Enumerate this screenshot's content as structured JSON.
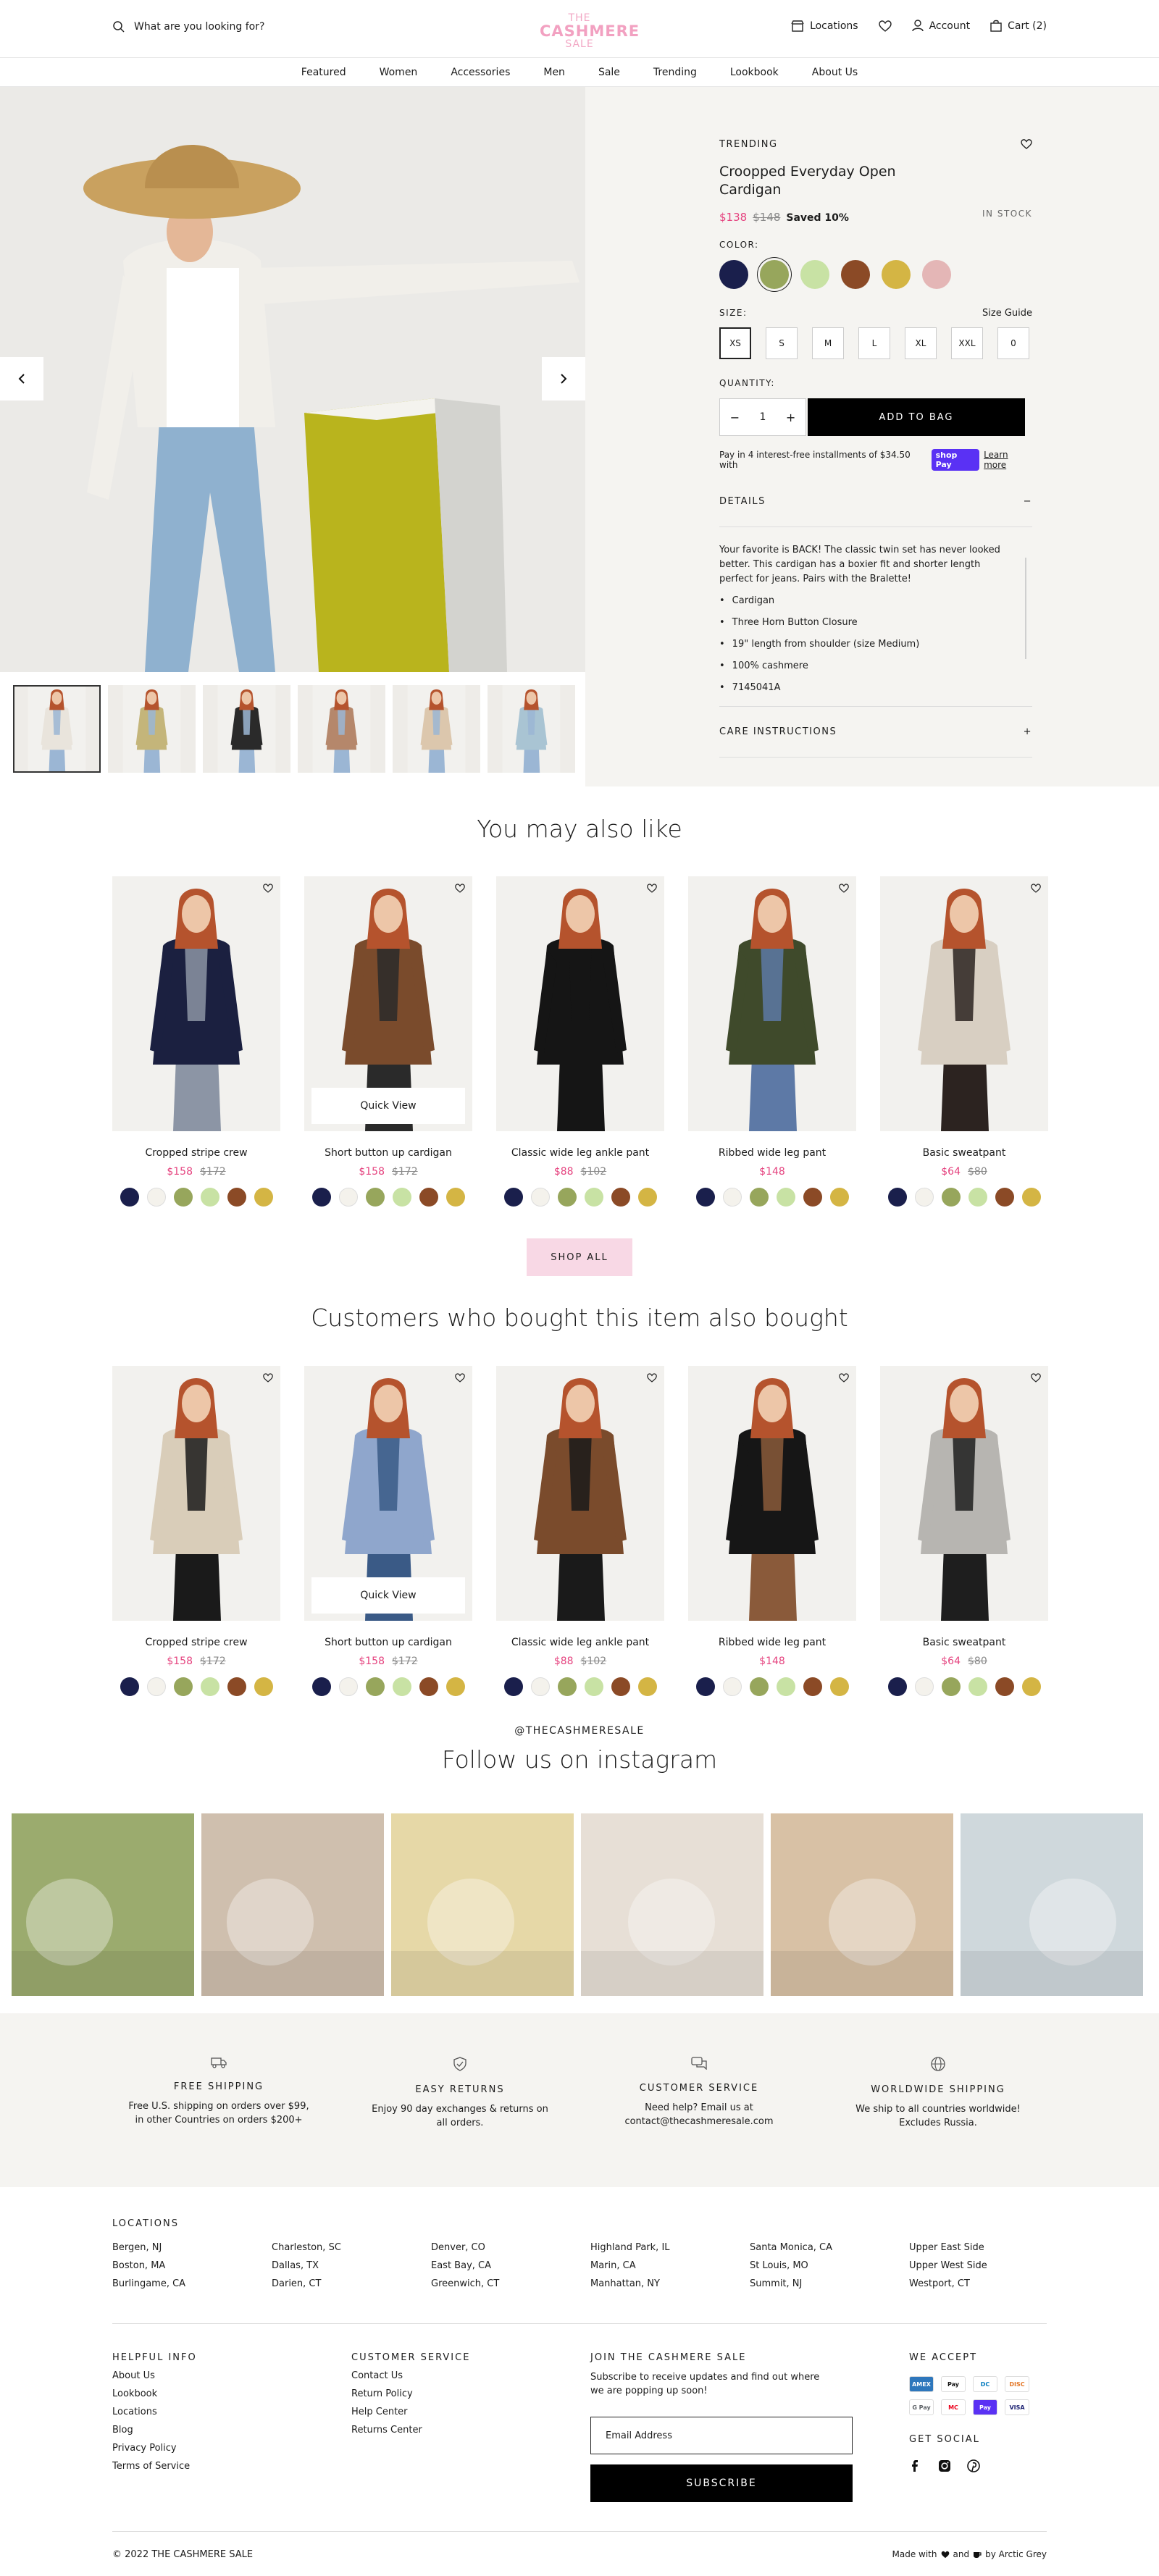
{
  "header": {
    "search_placeholder": "What are you looking for?",
    "logo_top": "THE",
    "logo_main": "CASHMERE",
    "logo_bottom": "SALE",
    "locations": "Locations",
    "account": "Account",
    "cart": "Cart (2)"
  },
  "nav": [
    "Featured",
    "Women",
    "Accessories",
    "Men",
    "Sale",
    "Trending",
    "Lookbook",
    "About Us"
  ],
  "product": {
    "tag": "TRENDING",
    "title": "Croopped Everyday Open Cardigan",
    "price": "$138",
    "compare_price": "$148",
    "saved": "Saved 10%",
    "stock": "IN STOCK",
    "color_label": "COLOR:",
    "colors": [
      "#1a1f4c",
      "#97a65c",
      "#c8e2a4",
      "#8b4a26",
      "#d4b544",
      "#e4b6b6"
    ],
    "selected_color": 1,
    "size_label": "SIZE:",
    "size_guide": "Size Guide",
    "sizes": [
      "XS",
      "S",
      "M",
      "L",
      "XL",
      "XXL",
      "0"
    ],
    "selected_size": 0,
    "quantity_label": "QUANTITY:",
    "quantity": "1",
    "add_to_bag": "ADD TO BAG",
    "pay_text": "Pay in 4 interest-free installments of $34.50 with",
    "shop_pay": "shop Pay",
    "learn_more": "Learn more",
    "details_label": "DETAILS",
    "details_text": "Your favorite is BACK! The classic twin set has never looked better. This cardigan has a boxier fit and shorter length perfect for jeans. Pairs with the Bralette!",
    "details_bullets": [
      "Cardigan",
      "Three Horn Button Closure",
      "19\" length from shoulder (size Medium)",
      "100% cashmere",
      "7145041A"
    ],
    "care_label": "CARE INSTRUCTIONS",
    "thumb_colors": [
      "#e9e4dc",
      "#c4b57a",
      "#2a2a2a",
      "#b5876b",
      "#dcc7ad",
      "#a9c4d3"
    ]
  },
  "swatch_colors": [
    "#1a1f4c",
    "#f4f2ec",
    "#97a65c",
    "#c8e2a4",
    "#8b4a26",
    "#d4b544"
  ],
  "also_like": {
    "title": "You may also like",
    "quick_view": "Quick View",
    "shop_all": "SHOP ALL",
    "items": [
      {
        "name": "Cropped stripe crew",
        "price": "$158",
        "compare": "$172",
        "garment": "#1b2040",
        "inner": "#8c95a5"
      },
      {
        "name": "Short button up cardigan",
        "price": "$158",
        "compare": "$172",
        "garment": "#7a4b2c",
        "inner": "#2a2a2a"
      },
      {
        "name": "Classic wide leg ankle pant",
        "price": "$88",
        "compare": "$102",
        "garment": "#151515",
        "inner": "#151515"
      },
      {
        "name": "Ribbed wide leg pant",
        "price": "$148",
        "compare": "",
        "garment": "#3f4a2b",
        "inner": "#5d79a6"
      },
      {
        "name": "Basic sweatpant",
        "price": "$64",
        "compare": "$80",
        "garment": "#d8cfc2",
        "inner": "#2c2320"
      }
    ]
  },
  "also_bought": {
    "title": "Customers who bought this item also bought",
    "items": [
      {
        "name": "Cropped stripe crew",
        "price": "$158",
        "compare": "$172",
        "garment": "#d9cdb9",
        "inner": "#1a1a1a"
      },
      {
        "name": "Short button up cardigan",
        "price": "$158",
        "compare": "$172",
        "garment": "#8fa6cc",
        "inner": "#3a5a86"
      },
      {
        "name": "Classic wide leg ankle pant",
        "price": "$88",
        "compare": "$102",
        "garment": "#7a4b2c",
        "inner": "#1a1a1a"
      },
      {
        "name": "Ribbed wide leg pant",
        "price": "$148",
        "compare": "",
        "garment": "#161616",
        "inner": "#8a5a3a"
      },
      {
        "name": "Basic sweatpant",
        "price": "$64",
        "compare": "$80",
        "garment": "#b7b5b1",
        "inner": "#1e1e1e"
      }
    ]
  },
  "instagram": {
    "handle": "@THECASHMERESALE",
    "title": "Follow us on instagram",
    "tiles": [
      "#9bab6e",
      "#cfbfae",
      "#e6d8a7",
      "#e7dfd6",
      "#d8c1a5",
      "#cfd8dc"
    ]
  },
  "features": [
    {
      "title": "FREE SHIPPING",
      "text": "Free U.S. shipping on orders over $99, in other Countries on orders $200+"
    },
    {
      "title": "EASY RETURNS",
      "text": "Enjoy 90 day exchanges & returns on all orders."
    },
    {
      "title": "CUSTOMER SERVICE",
      "text": "Need help? Email us at contact@thecashmeresale.com"
    },
    {
      "title": "WORLDWIDE SHIPPING",
      "text": "We ship to all countries worldwide! Excludes Russia."
    }
  ],
  "footer": {
    "locations_title": "LOCATIONS",
    "locations": [
      "Bergen, NJ",
      "Charleston, SC",
      "Denver, CO",
      "Highland Park, IL",
      "Santa Monica, CA",
      "Upper East Side",
      "Boston, MA",
      "Dallas, TX",
      "East Bay, CA",
      "Marin, CA",
      "St Louis, MO",
      "Upper West Side",
      "Burlingame, CA",
      "Darien, CT",
      "Greenwich, CT",
      "Manhattan, NY",
      "Summit, NJ",
      "Westport, CT"
    ],
    "helpful_title": "HELPFUL INFO",
    "helpful": [
      "About Us",
      "Lookbook",
      "Locations",
      "Blog",
      "Privacy Policy",
      "Terms of Service"
    ],
    "service_title": "CUSTOMER SERVICE",
    "service": [
      "Contact Us",
      "Return Policy",
      "Help Center",
      "Returns Center"
    ],
    "join_title": "JOIN THE CASHMERE SALE",
    "join_text": "Subscribe  to receive updates and find out where we are popping up soon!",
    "email_placeholder": "Email Address",
    "subscribe": "SUBSCRIBE",
    "accept_title": "WE ACCEPT",
    "payments": [
      "AMEX",
      "Pay",
      "DC",
      "DISC",
      "G Pay",
      "MC",
      "Pay",
      "VISA"
    ],
    "social_title": "GET SOCIAL",
    "copyright": "© 2022 THE CASHMERE SALE",
    "made_with": "Made with",
    "and": "and",
    "by": "by Arctic Grey"
  }
}
